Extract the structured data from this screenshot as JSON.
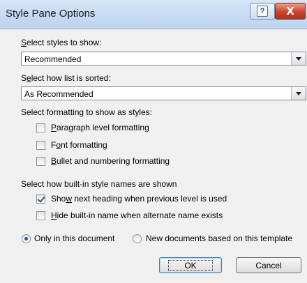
{
  "window": {
    "title": "Style Pane Options",
    "help_glyph": "?",
    "close_glyph": "X"
  },
  "styles_to_show": {
    "label_access_key": "S",
    "label_rest": "elect styles to show:",
    "selected": "Recommended"
  },
  "list_sorted": {
    "label_lead": "S",
    "label_access_key": "e",
    "label_rest": "lect how list is sorted:",
    "selected": "As Recommended"
  },
  "formatting": {
    "label": "Select formatting to show as styles:",
    "options": [
      {
        "access_key": "P",
        "text": "aragraph level formatting",
        "checked": false
      },
      {
        "lead": "F",
        "access_key": "o",
        "text": "nt formatting",
        "checked": false
      },
      {
        "access_key": "B",
        "text": "ullet and numbering formatting",
        "checked": false
      }
    ]
  },
  "builtin": {
    "label": "Select how built-in style names are shown",
    "options": [
      {
        "lead": "Sho",
        "access_key": "w",
        "text": " next heading when previous level is used",
        "checked": true
      },
      {
        "access_key": "H",
        "text": "ide built-in name when alternate name exists",
        "checked": false
      }
    ]
  },
  "scope": {
    "options": [
      {
        "label": "Only in this document",
        "selected": true
      },
      {
        "label": "New documents based on this template",
        "selected": false
      }
    ]
  },
  "buttons": {
    "ok": "OK",
    "cancel": "Cancel"
  }
}
